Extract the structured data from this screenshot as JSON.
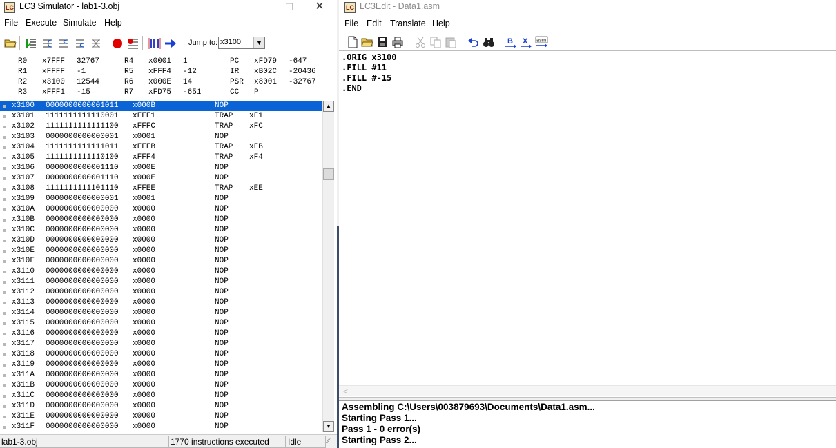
{
  "simulator": {
    "title": "LC3 Simulator - lab1-3.obj",
    "menu": [
      "File",
      "Execute",
      "Simulate",
      "Help"
    ],
    "jump_label": "Jump to:",
    "jump_value": "x3100",
    "registers": [
      {
        "name": "R0",
        "hex": "x7FFF",
        "dec": "32767"
      },
      {
        "name": "R1",
        "hex": "xFFFF",
        "dec": "-1"
      },
      {
        "name": "R2",
        "hex": "x3100",
        "dec": "12544"
      },
      {
        "name": "R3",
        "hex": "xFFF1",
        "dec": "-15"
      },
      {
        "name": "R4",
        "hex": "x0001",
        "dec": "1"
      },
      {
        "name": "R5",
        "hex": "xFFF4",
        "dec": "-12"
      },
      {
        "name": "R6",
        "hex": "x000E",
        "dec": "14"
      },
      {
        "name": "R7",
        "hex": "xFD75",
        "dec": "-651"
      },
      {
        "name": "PC",
        "hex": "xFD79",
        "dec": "-647"
      },
      {
        "name": "IR",
        "hex": "xB02C",
        "dec": "-20436"
      },
      {
        "name": "PSR",
        "hex": "x8001",
        "dec": "-32767"
      },
      {
        "name": "CC",
        "hex": "P",
        "dec": ""
      }
    ],
    "memory": [
      {
        "addr": "x3100",
        "bin": "0000000000001011",
        "hex": "x000B",
        "op": "NOP",
        "arg": ""
      },
      {
        "addr": "x3101",
        "bin": "1111111111110001",
        "hex": "xFFF1",
        "op": "TRAP",
        "arg": "xF1"
      },
      {
        "addr": "x3102",
        "bin": "1111111111111100",
        "hex": "xFFFC",
        "op": "TRAP",
        "arg": "xFC"
      },
      {
        "addr": "x3103",
        "bin": "0000000000000001",
        "hex": "x0001",
        "op": "NOP",
        "arg": ""
      },
      {
        "addr": "x3104",
        "bin": "1111111111111011",
        "hex": "xFFFB",
        "op": "TRAP",
        "arg": "xFB"
      },
      {
        "addr": "x3105",
        "bin": "1111111111110100",
        "hex": "xFFF4",
        "op": "TRAP",
        "arg": "xF4"
      },
      {
        "addr": "x3106",
        "bin": "0000000000001110",
        "hex": "x000E",
        "op": "NOP",
        "arg": ""
      },
      {
        "addr": "x3107",
        "bin": "0000000000001110",
        "hex": "x000E",
        "op": "NOP",
        "arg": ""
      },
      {
        "addr": "x3108",
        "bin": "1111111111101110",
        "hex": "xFFEE",
        "op": "TRAP",
        "arg": "xEE"
      },
      {
        "addr": "x3109",
        "bin": "0000000000000001",
        "hex": "x0001",
        "op": "NOP",
        "arg": ""
      },
      {
        "addr": "x310A",
        "bin": "0000000000000000",
        "hex": "x0000",
        "op": "NOP",
        "arg": ""
      },
      {
        "addr": "x310B",
        "bin": "0000000000000000",
        "hex": "x0000",
        "op": "NOP",
        "arg": ""
      },
      {
        "addr": "x310C",
        "bin": "0000000000000000",
        "hex": "x0000",
        "op": "NOP",
        "arg": ""
      },
      {
        "addr": "x310D",
        "bin": "0000000000000000",
        "hex": "x0000",
        "op": "NOP",
        "arg": ""
      },
      {
        "addr": "x310E",
        "bin": "0000000000000000",
        "hex": "x0000",
        "op": "NOP",
        "arg": ""
      },
      {
        "addr": "x310F",
        "bin": "0000000000000000",
        "hex": "x0000",
        "op": "NOP",
        "arg": ""
      },
      {
        "addr": "x3110",
        "bin": "0000000000000000",
        "hex": "x0000",
        "op": "NOP",
        "arg": ""
      },
      {
        "addr": "x3111",
        "bin": "0000000000000000",
        "hex": "x0000",
        "op": "NOP",
        "arg": ""
      },
      {
        "addr": "x3112",
        "bin": "0000000000000000",
        "hex": "x0000",
        "op": "NOP",
        "arg": ""
      },
      {
        "addr": "x3113",
        "bin": "0000000000000000",
        "hex": "x0000",
        "op": "NOP",
        "arg": ""
      },
      {
        "addr": "x3114",
        "bin": "0000000000000000",
        "hex": "x0000",
        "op": "NOP",
        "arg": ""
      },
      {
        "addr": "x3115",
        "bin": "0000000000000000",
        "hex": "x0000",
        "op": "NOP",
        "arg": ""
      },
      {
        "addr": "x3116",
        "bin": "0000000000000000",
        "hex": "x0000",
        "op": "NOP",
        "arg": ""
      },
      {
        "addr": "x3117",
        "bin": "0000000000000000",
        "hex": "x0000",
        "op": "NOP",
        "arg": ""
      },
      {
        "addr": "x3118",
        "bin": "0000000000000000",
        "hex": "x0000",
        "op": "NOP",
        "arg": ""
      },
      {
        "addr": "x3119",
        "bin": "0000000000000000",
        "hex": "x0000",
        "op": "NOP",
        "arg": ""
      },
      {
        "addr": "x311A",
        "bin": "0000000000000000",
        "hex": "x0000",
        "op": "NOP",
        "arg": ""
      },
      {
        "addr": "x311B",
        "bin": "0000000000000000",
        "hex": "x0000",
        "op": "NOP",
        "arg": ""
      },
      {
        "addr": "x311C",
        "bin": "0000000000000000",
        "hex": "x0000",
        "op": "NOP",
        "arg": ""
      },
      {
        "addr": "x311D",
        "bin": "0000000000000000",
        "hex": "x0000",
        "op": "NOP",
        "arg": ""
      },
      {
        "addr": "x311E",
        "bin": "0000000000000000",
        "hex": "x0000",
        "op": "NOP",
        "arg": ""
      },
      {
        "addr": "x311F",
        "bin": "0000000000000000",
        "hex": "x0000",
        "op": "NOP",
        "arg": ""
      }
    ],
    "status": {
      "file": "lab1-3.obj",
      "executed": "1770 instructions executed",
      "state": "Idle"
    },
    "selection_color": "#0A64D6"
  },
  "editor": {
    "title": "LC3Edit - Data1.asm",
    "menu": [
      "File",
      "Edit",
      "Translate",
      "Help"
    ],
    "code": [
      ".ORIG x3100",
      ".FILL #11",
      ".FILL #-15",
      ".END"
    ],
    "output": [
      "Assembling C:\\Users\\003879693\\Documents\\Data1.asm...",
      "Starting Pass 1...",
      "Pass 1 - 0 error(s)",
      "Starting Pass 2..."
    ]
  }
}
